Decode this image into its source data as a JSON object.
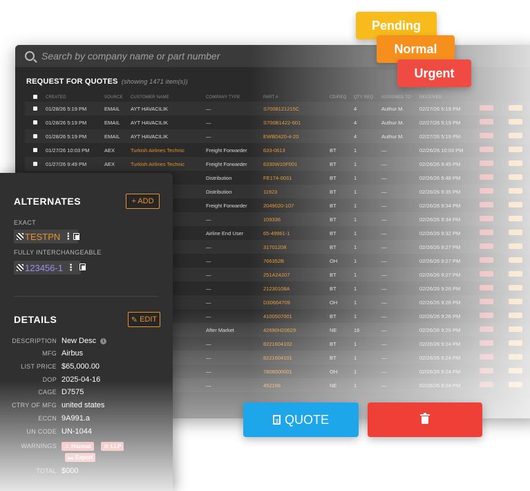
{
  "search": {
    "placeholder": "Search by company name or part number"
  },
  "rfq": {
    "title": "REQUEST FOR QUOTES",
    "showing": "(showing 1471 item(s))",
    "columns": [
      "CREATED",
      "SOURCE",
      "CUSTOMER NAME",
      "COMPANY TYPE",
      "PART #",
      "CD/REQ",
      "QTY REQ",
      "ASSIGNED TO",
      "RECEIVED"
    ],
    "rows": [
      {
        "created": "01/28/26 5:19 PM",
        "source": "EMAIL",
        "customer": "AYT HAVACILIK",
        "type": "—",
        "part": "S7008121215C",
        "cd": "",
        "qty": "4",
        "assigned": "Authur M.",
        "received": "02/27/26 5:19 PM"
      },
      {
        "created": "01/28/26 5:19 PM",
        "source": "EMAIL",
        "customer": "AYT HAVACILIK",
        "type": "—",
        "part": "S700B1422-601",
        "cd": "",
        "qty": "4",
        "assigned": "Authur M.",
        "received": "02/27/26 5:19 PM"
      },
      {
        "created": "01/28/26 5:19 PM",
        "source": "EMAIL",
        "customer": "AYT HAVACILIK",
        "type": "—",
        "part": "EWB0420-4-20",
        "cd": "",
        "qty": "4",
        "assigned": "Authur M.",
        "received": "02/27/26 5:19 PM"
      },
      {
        "created": "01/27/26 10:03 PM",
        "source": "AEX",
        "customer": "Turkish Airlines Technic",
        "type": "Freight Forwarder",
        "part": "633-0613",
        "cd": "BT",
        "qty": "1",
        "assigned": "—",
        "received": "02/26/26 10:03 PM"
      },
      {
        "created": "01/27/26 9:49 PM",
        "source": "AEX",
        "customer": "Turkish Airlines Technic",
        "type": "Freight Forwarder",
        "part": "6330W10F001",
        "cd": "BT",
        "qty": "1",
        "assigned": "—",
        "received": "02/26/26 9:45 PM"
      },
      {
        "created": "",
        "source": "",
        "customer": "vices",
        "type": "Distribution",
        "part": "FE174-0031",
        "cd": "BT",
        "qty": "1",
        "assigned": "—",
        "received": "02/26/26 9:48 PM"
      },
      {
        "created": "",
        "source": "",
        "customer": "vices",
        "type": "Distribution",
        "part": "11923",
        "cd": "BT",
        "qty": "1",
        "assigned": "—",
        "received": "02/26/26 9:35 PM"
      },
      {
        "created": "",
        "source": "",
        "customer": "chnic",
        "type": "Freight Forwarder",
        "part": "2049020-107",
        "cd": "BT",
        "qty": "1",
        "assigned": "—",
        "received": "02/26/26 9:34 PM"
      },
      {
        "created": "",
        "source": "",
        "customer": "viation",
        "type": "—",
        "part": "109336",
        "cd": "BT",
        "qty": "1",
        "assigned": "—",
        "received": "02/26/26 9:34 PM"
      },
      {
        "created": "",
        "source": "",
        "customer": "",
        "type": "Airline End User",
        "part": "65-49961-1",
        "cd": "BT",
        "qty": "1",
        "assigned": "—",
        "received": "02/26/26 9:32 PM"
      },
      {
        "created": "",
        "source": "",
        "customer": "",
        "type": "—",
        "part": "31701208",
        "cd": "BT",
        "qty": "1",
        "assigned": "—",
        "received": "02/26/26 9:27 PM"
      },
      {
        "created": "",
        "source": "",
        "customer": "",
        "type": "—",
        "part": "766352B",
        "cd": "OH",
        "qty": "1",
        "assigned": "—",
        "received": "02/26/26 9:27 PM"
      },
      {
        "created": "",
        "source": "",
        "customer": "",
        "type": "—",
        "part": "251A24207",
        "cd": "BT",
        "qty": "1",
        "assigned": "—",
        "received": "02/26/26 9:27 PM"
      },
      {
        "created": "",
        "source": "",
        "customer": "",
        "type": "—",
        "part": "21230108A",
        "cd": "BT",
        "qty": "1",
        "assigned": "—",
        "received": "02/26/26 9:26 PM"
      },
      {
        "created": "",
        "source": "",
        "customer": "",
        "type": "—",
        "part": "D30664709",
        "cd": "OH",
        "qty": "1",
        "assigned": "—",
        "received": "02/26/26 9:26 PM"
      },
      {
        "created": "",
        "source": "",
        "customer": "",
        "type": "—",
        "part": "4100507001",
        "cd": "BT",
        "qty": "1",
        "assigned": "—",
        "received": "02/26/26 9:26 PM"
      },
      {
        "created": "",
        "source": "",
        "customer": "",
        "type": "After Market",
        "part": "42690H20629",
        "cd": "NE",
        "qty": "16",
        "assigned": "—",
        "received": "02/26/26 9:25 PM"
      },
      {
        "created": "",
        "source": "",
        "customer": "",
        "type": "—",
        "part": "8221604102",
        "cd": "BT",
        "qty": "1",
        "assigned": "—",
        "received": "02/26/26 9:24 PM"
      },
      {
        "created": "",
        "source": "",
        "customer": "",
        "type": "—",
        "part": "8221604101",
        "cd": "BT",
        "qty": "1",
        "assigned": "—",
        "received": "02/26/26 9:24 PM"
      },
      {
        "created": "",
        "source": "",
        "customer": "",
        "type": "—",
        "part": "7808000001",
        "cd": "OH",
        "qty": "1",
        "assigned": "—",
        "received": "02/26/26 9:24 PM"
      },
      {
        "created": "",
        "source": "",
        "customer": "",
        "type": "—",
        "part": "452166",
        "cd": "NE",
        "qty": "1",
        "assigned": "—",
        "received": "02/26/26 9:24 PM"
      }
    ]
  },
  "tags": {
    "pending": "Pending",
    "normal": "Normal",
    "urgent": "Urgent"
  },
  "alternates": {
    "title": "ALTERNATES",
    "add_label": "+ ADD",
    "exact_label": "EXACT",
    "exact_pn": "TESTPN",
    "fully_label": "FULLY INTERCHANGEABLE",
    "fully_pn": "123456-1"
  },
  "details": {
    "title": "DETAILS",
    "edit_label": "EDIT",
    "description_label": "DESCRIPTION",
    "description": "New Desc",
    "mfg_label": "MFG",
    "mfg": "Airbus",
    "list_price_label": "LIST PRICE",
    "list_price": "$65,000.00",
    "dop_label": "DOP",
    "dop": "2025-04-16",
    "cage_label": "CAGE",
    "cage": "D7575",
    "ctry_label": "CTRY OF MFG",
    "ctry": "united states",
    "eccn_label": "ECCN",
    "eccn": "9A991.a",
    "un_label": "UN CODE",
    "un": "UN-1044",
    "warnings_label": "WARNINGS",
    "warnings": [
      "Hazmat",
      "LLP",
      "Export"
    ],
    "total_label": "TOTAL",
    "total": "$000"
  },
  "actions": {
    "quote_label": "QUOTE"
  },
  "colors": {
    "accent_orange": "#e8942b",
    "pending": "#f7bb1c",
    "normal": "#f78f1d",
    "urgent": "#ef4b43",
    "quote": "#1ea6ea",
    "delete": "#ef4037"
  }
}
